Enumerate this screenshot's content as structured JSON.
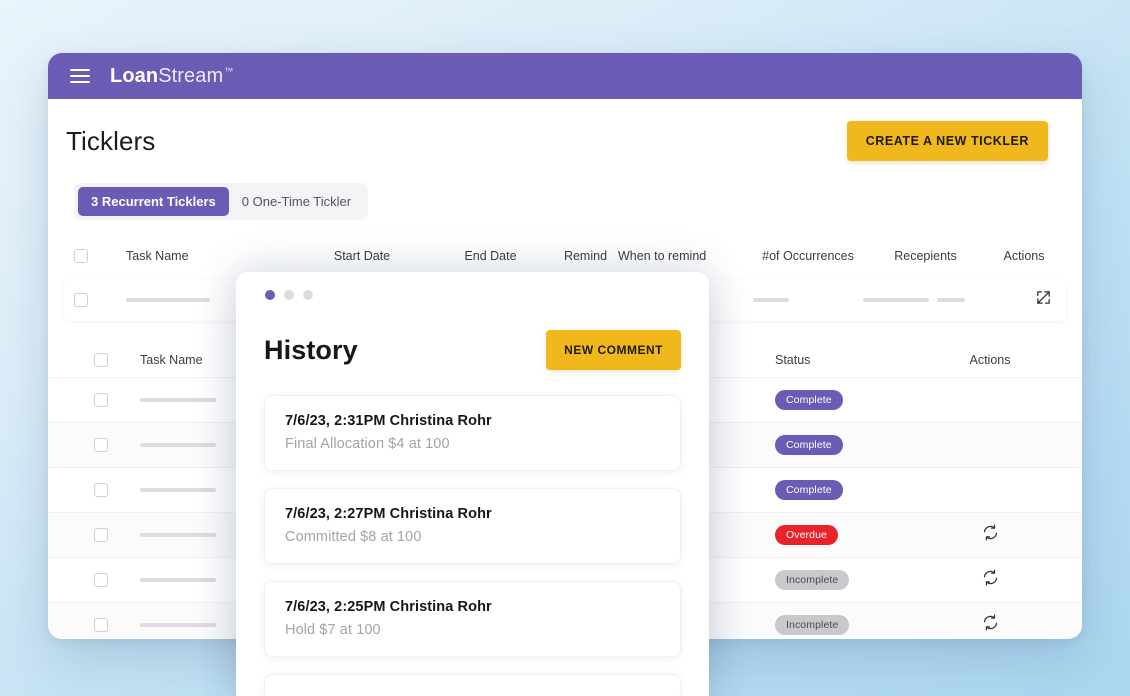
{
  "app": {
    "brand_strong": "Loan",
    "brand_light": "Stream",
    "brand_tm": "™",
    "menu_icon": "hamburger-icon"
  },
  "page": {
    "title": "Ticklers",
    "create_button": "CREATE A NEW TICKLER"
  },
  "tabs": [
    {
      "label": "3 Recurrent Ticklers",
      "active": true
    },
    {
      "label": "0 One-Time Tickler",
      "active": false
    }
  ],
  "table_one": {
    "columns": [
      "",
      "Task Name",
      "Start Date",
      "End Date",
      "Remind",
      "When to remind",
      "#of Occurrences",
      "Recepients",
      "Actions"
    ],
    "rows": [
      {
        "action_icon": "edit-icon"
      }
    ]
  },
  "table_two": {
    "columns": [
      "",
      "Task Name",
      "",
      "Status",
      "Actions"
    ],
    "rows": [
      {
        "status": "Complete",
        "status_kind": "complete",
        "action_icon": ""
      },
      {
        "status": "Complete",
        "status_kind": "complete",
        "action_icon": ""
      },
      {
        "status": "Complete",
        "status_kind": "complete",
        "action_icon": ""
      },
      {
        "status": "Overdue",
        "status_kind": "overdue",
        "action_icon": "refresh-icon"
      },
      {
        "status": "Incomplete",
        "status_kind": "incomplete",
        "action_icon": "refresh-icon"
      },
      {
        "status": "Incomplete",
        "status_kind": "incomplete",
        "action_icon": "refresh-icon"
      }
    ]
  },
  "modal": {
    "title": "History",
    "new_comment_button": "NEW COMMENT",
    "dots": [
      {
        "active": true
      },
      {
        "active": false
      },
      {
        "active": false
      }
    ],
    "entries": [
      {
        "meta": "7/6/23, 2:31PM Christina Rohr",
        "detail": "Final Allocation $4 at 100"
      },
      {
        "meta": "7/6/23, 2:27PM Christina Rohr",
        "detail": "Committed $8 at 100"
      },
      {
        "meta": "7/6/23, 2:25PM Christina Rohr",
        "detail": "Hold $7 at 100"
      }
    ]
  },
  "colors": {
    "brand_purple": "#6a5bb5",
    "accent_yellow": "#f0b81d",
    "status_overdue": "#e8232a",
    "status_incomplete": "#c9c9cd",
    "page_background": "#bfe0f4"
  }
}
